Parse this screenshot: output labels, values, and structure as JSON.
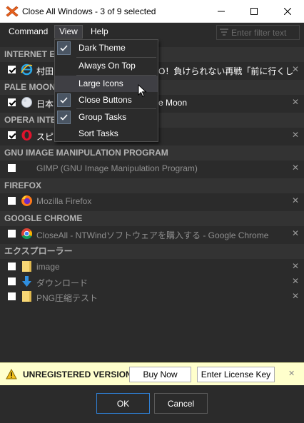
{
  "window": {
    "title": "Close All Windows - 3 of 9 selected",
    "minimize_glyph": "—",
    "maximize_glyph": "☐",
    "close_glyph": "✕"
  },
  "menu": {
    "command": "Command",
    "view": "View",
    "help": "Help"
  },
  "filter": {
    "placeholder": "Enter filter text"
  },
  "view_menu": {
    "items": [
      {
        "label": "Dark Theme",
        "checked": true
      },
      {
        "label": "Always On Top",
        "checked": false
      },
      {
        "label": "Large Icons",
        "checked": false,
        "hovered": true
      },
      {
        "label": "Close Buttons",
        "checked": true
      },
      {
        "label": "Group Tasks",
        "checked": true
      },
      {
        "label": "Sort Tasks",
        "checked": false
      }
    ]
  },
  "groups": [
    {
      "name": "INTERNET EX",
      "tasks": [
        {
          "title": "村田",
          "title_tail": "O！負けられない再戦「前に行くし",
          "checked": true,
          "icon": "internet-explorer-icon"
        }
      ]
    },
    {
      "name": "PALE MOON",
      "tasks": [
        {
          "title": "日本",
          "title_tail": "e Moon",
          "checked": true,
          "icon": "pale-moon-icon"
        }
      ]
    },
    {
      "name": "OPERA INTE",
      "tasks": [
        {
          "title": "スピー",
          "title_tail": "",
          "checked": true,
          "icon": "opera-icon"
        }
      ]
    },
    {
      "name": "GNU IMAGE MANIPULATION PROGRAM",
      "tasks": [
        {
          "title": "GIMP (GNU Image Manipulation Program)",
          "checked": false,
          "icon": ""
        }
      ]
    },
    {
      "name": "FIREFOX",
      "tasks": [
        {
          "title": "Mozilla Firefox",
          "checked": false,
          "icon": "firefox-icon"
        }
      ]
    },
    {
      "name": "GOOGLE CHROME",
      "tasks": [
        {
          "title": "CloseAll - NTWindソフトウェアを購入する - Google Chrome",
          "checked": false,
          "icon": "chrome-icon"
        }
      ]
    },
    {
      "name": "エクスプローラー",
      "tasks": [
        {
          "title": "image",
          "checked": false,
          "icon": "folder-icon"
        },
        {
          "title": "ダウンロード",
          "checked": false,
          "icon": "download-folder-icon"
        },
        {
          "title": "PNG圧縮テスト",
          "checked": false,
          "icon": "folder-icon"
        }
      ]
    }
  ],
  "banner": {
    "text": "UNREGISTERED VERSION",
    "buy_now": "Buy Now",
    "enter_license": "Enter License Key",
    "close_glyph": "✕"
  },
  "buttons": {
    "ok": "OK",
    "cancel": "Cancel"
  },
  "row_close_glyph": "✕",
  "colors": {
    "background": "#2b2b2b",
    "group_header": "#333333",
    "banner": "#ffffcc",
    "primary_border": "#2f7fd4",
    "title_icon": "#e8621e"
  }
}
